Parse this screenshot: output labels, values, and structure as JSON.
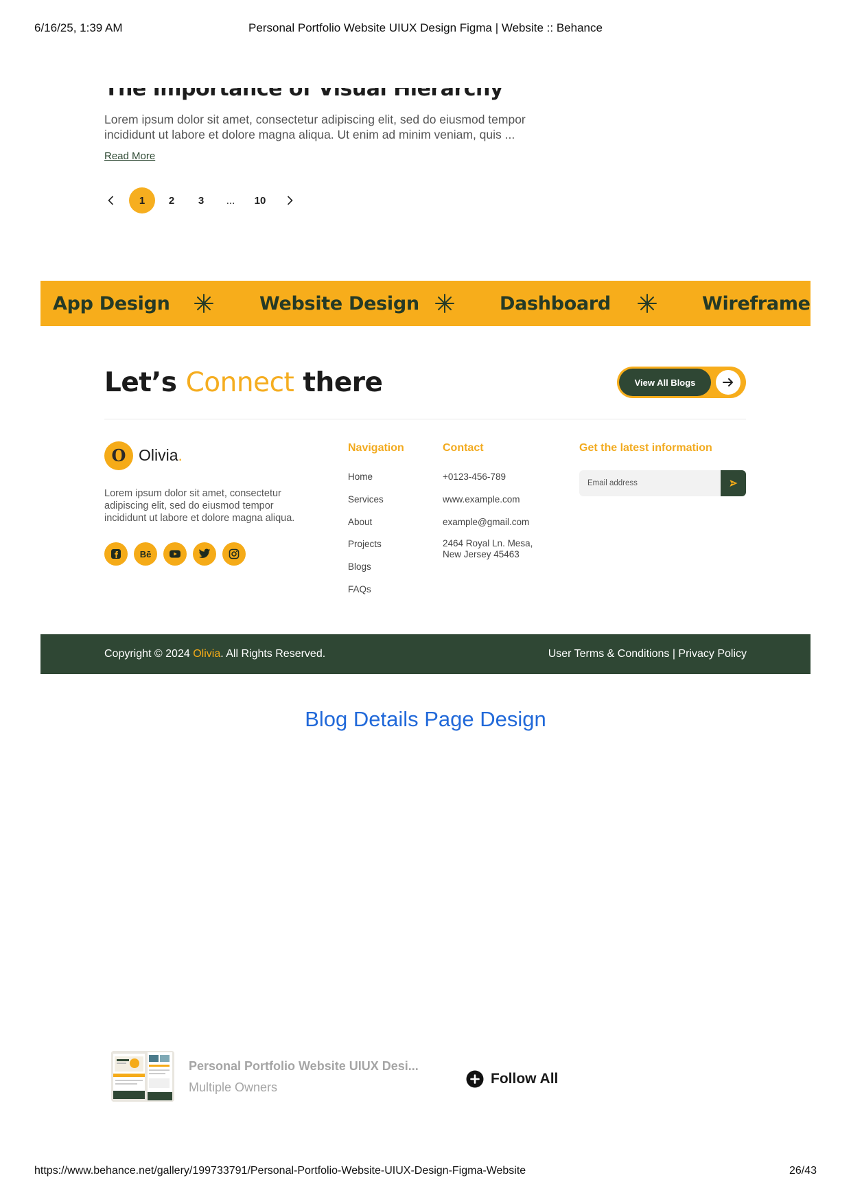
{
  "print": {
    "date": "6/16/25, 1:39 AM",
    "title": "Personal Portfolio Website UIUX Design Figma | Website :: Behance",
    "url": "https://www.behance.net/gallery/199733791/Personal-Portfolio-Website-UIUX-Design-Figma-Website",
    "page": "26/43"
  },
  "blog": {
    "heading_partial": "The Importance of Visual Hierarchy in Web Design",
    "excerpt": "Lorem ipsum dolor sit amet, consectetur adipiscing elit, sed do eiusmod tempor incididunt ut labore et dolore magna aliqua. Ut enim ad minim veniam, quis ...",
    "read_more": "Read More"
  },
  "pagination": {
    "pages": [
      "1",
      "2",
      "3",
      "...",
      "10"
    ],
    "active": "1"
  },
  "band": {
    "items": [
      "App Design",
      "Website Design",
      "Dashboard",
      "Wireframe"
    ],
    "color": "#f7ad1b"
  },
  "connect": {
    "before": "Let’s",
    "accent": "Connect",
    "after": "there",
    "button": "View All Blogs"
  },
  "footer": {
    "logo_letter": "O",
    "brand": "Olivia",
    "brand_dot": ".",
    "about": "Lorem ipsum dolor sit amet, consectetur adipiscing elit, sed do eiusmod tempor incididunt ut labore et dolore magna aliqua.",
    "socials": [
      "facebook-icon",
      "behance-icon",
      "youtube-icon",
      "twitter-icon",
      "instagram-icon"
    ],
    "behance_text": "Bē",
    "navigation": {
      "heading": "Navigation",
      "items": [
        "Home",
        "Services",
        "About",
        "Projects",
        "Blogs",
        "FAQs"
      ]
    },
    "contact": {
      "heading": "Contact",
      "items": [
        "+0123-456-789",
        "www.example.com",
        "example@gmail.com",
        "2464 Royal Ln. Mesa, New Jersey 45463"
      ]
    },
    "newsletter": {
      "heading": "Get the latest information",
      "placeholder": "Email address"
    }
  },
  "copyright": {
    "prefix": "Copyright © 2024",
    "name": "Olivia",
    "suffix": ". All Rights Reserved.",
    "terms": "User Terms & Conditions",
    "separator": "|",
    "privacy": "Privacy Policy"
  },
  "section_title": "Blog Details Page Design",
  "project_card": {
    "title": "Personal Portfolio Website UIUX Desi...",
    "owners": "Multiple Owners",
    "follow": "Follow All"
  },
  "colors": {
    "accent": "#f5ab18",
    "dark_green": "#2f4734",
    "link_blue": "#2169d9"
  }
}
